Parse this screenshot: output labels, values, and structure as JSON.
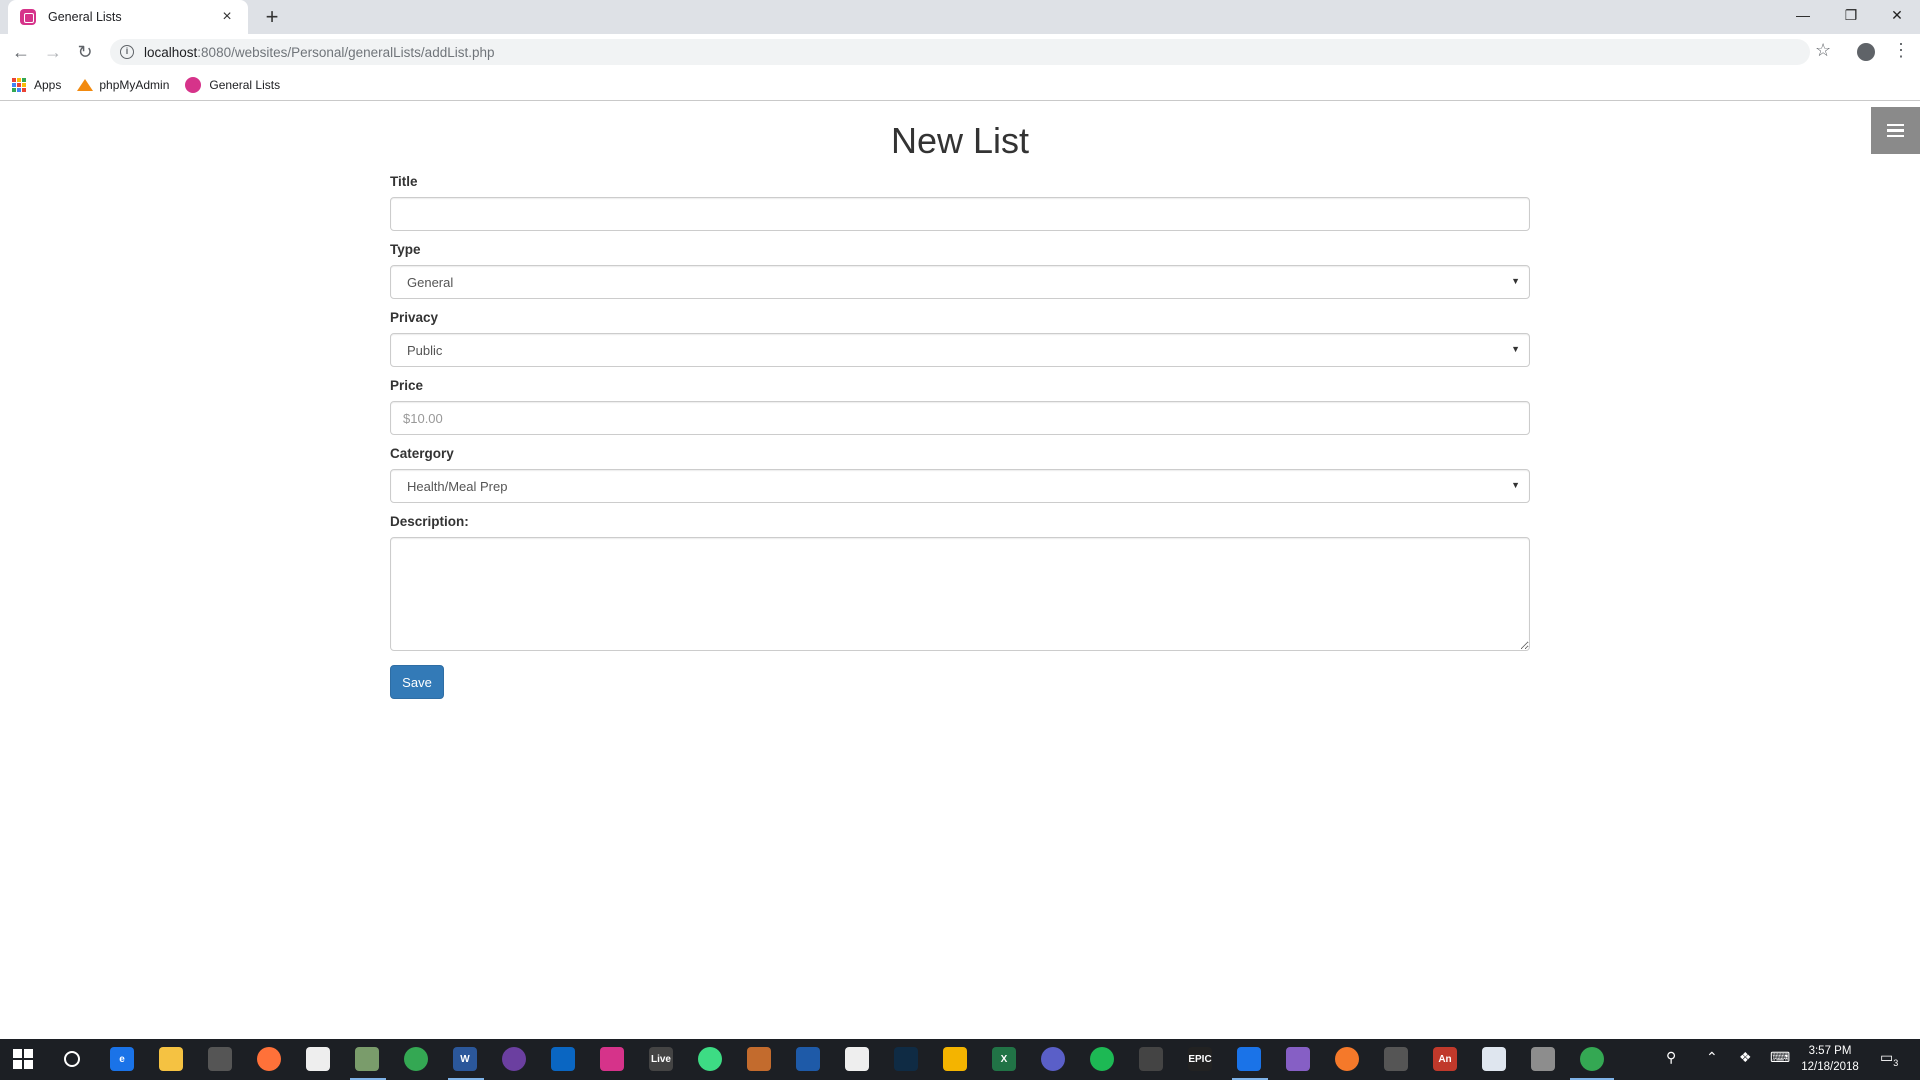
{
  "browser": {
    "tab_title": "General Lists",
    "tab_close": "×",
    "new_tab": "+",
    "window_controls": {
      "minimize": "—",
      "restore": "❐",
      "close": "✕"
    },
    "nav": {
      "back": "←",
      "forward": "→",
      "reload": "↻"
    },
    "address": {
      "host": "localhost",
      "path": ":8080/websites/Personal/generalLists/addList.php"
    },
    "star": "☆",
    "menu": "⋮",
    "bookmarks": [
      {
        "label": "Apps",
        "icon": "apps-grid-icon"
      },
      {
        "label": "phpMyAdmin",
        "icon": "phpmyadmin-icon"
      },
      {
        "label": "General Lists",
        "icon": "general-lists-icon"
      }
    ]
  },
  "page": {
    "title": "New List",
    "fields": {
      "title": {
        "label": "Title",
        "value": ""
      },
      "type": {
        "label": "Type",
        "selected": "General"
      },
      "privacy": {
        "label": "Privacy",
        "selected": "Public"
      },
      "price": {
        "label": "Price",
        "placeholder": "$10.00"
      },
      "category": {
        "label": "Catergory",
        "selected": "Health/Meal Prep"
      },
      "description": {
        "label": "Description:",
        "value": ""
      }
    },
    "save_label": "Save"
  },
  "taskbar": {
    "clock": {
      "time": "3:57 PM",
      "date": "12/18/2018"
    },
    "notification_count": "3",
    "colors": {
      "background": "#1c1f24",
      "active_indicator": "#7fb3e8"
    }
  },
  "colors": {
    "primary_button": "#337ab7",
    "hamburger_bg": "#8a8a8a",
    "brand_favicon": "#d6338a"
  }
}
